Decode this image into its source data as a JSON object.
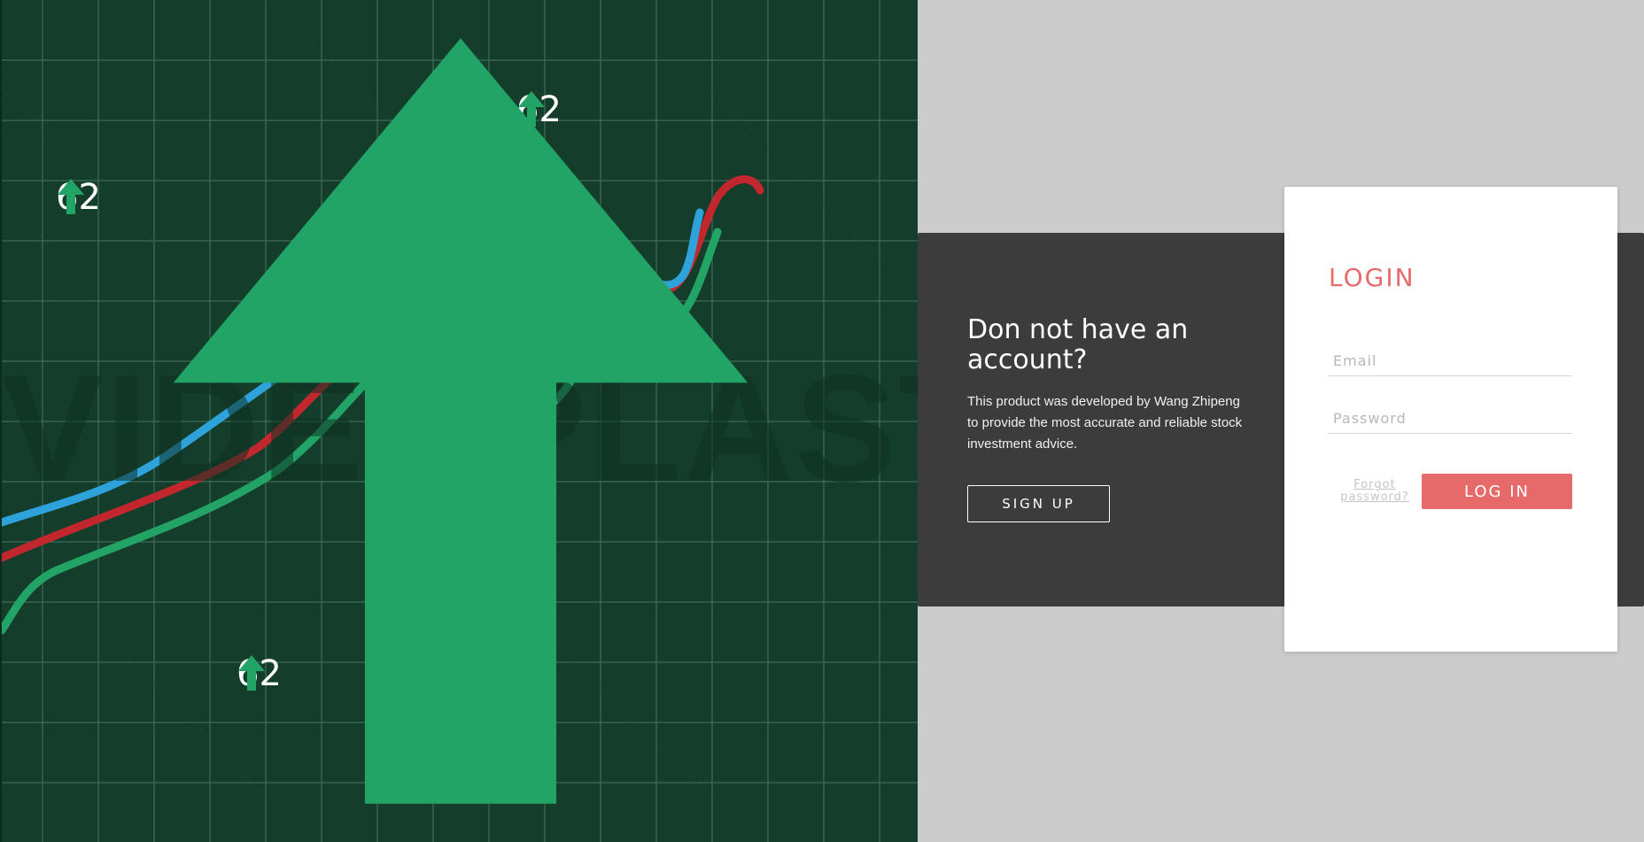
{
  "colors": {
    "hero_background": "#143d2b",
    "grid_line": "#3f6e58",
    "series_blue": "#2ea3db",
    "series_red": "#c1272d",
    "series_green": "#22a466",
    "marker": "#f3e58f",
    "accent": "#e66a6a",
    "panel_dark": "#3c3c3c",
    "page_background": "#cccccc"
  },
  "hero": {
    "watermark": "VIDEOPLASTY",
    "stats": [
      {
        "value": "62",
        "icon": "up-arrow-icon"
      },
      {
        "value": "62",
        "icon": "up-arrow-icon"
      },
      {
        "value": "62",
        "icon": "up-arrow-icon"
      }
    ],
    "small_icon": "up-arrow-icon"
  },
  "signup": {
    "title": "Don not have an account?",
    "description": "This product was developed by Wang Zhipeng to provide the most accurate and reliable stock investment advice.",
    "button_label": "SIGN UP"
  },
  "login": {
    "title": "LOGIN",
    "email_placeholder": "Email",
    "password_placeholder": "Password",
    "forgot_label": "Forgot password?",
    "button_label": "LOG IN"
  }
}
